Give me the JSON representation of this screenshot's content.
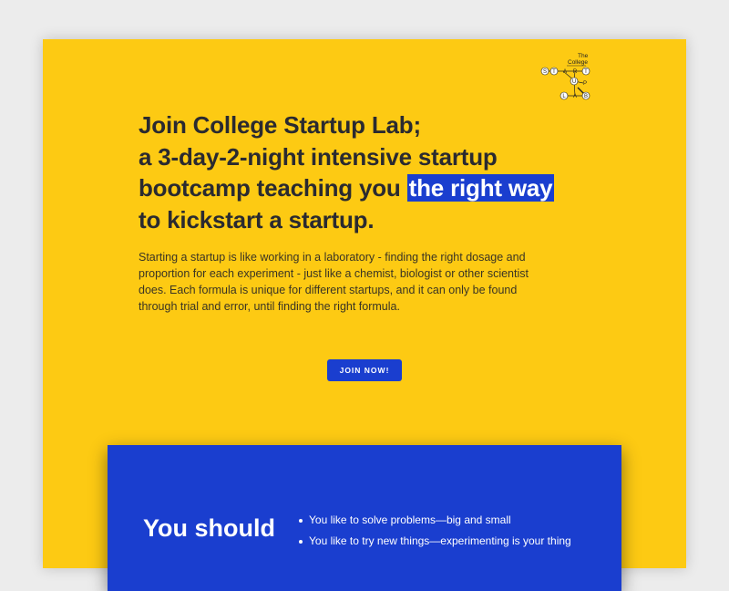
{
  "logo": {
    "title_line1": "The",
    "title_line2": "College",
    "letters": [
      "S",
      "T",
      "A",
      "R",
      "T",
      "U",
      "P",
      "L",
      "A",
      "B"
    ]
  },
  "hero": {
    "headline_line1": "Join College Startup Lab;",
    "headline_line2": "a 3-day-2-night intensive startup",
    "headline_line3_pre": "bootcamp teaching you ",
    "headline_line3_highlight": "the right way",
    "headline_line4": "to kickstart a startup.",
    "intro": "Starting a startup is like working in a laboratory - finding the right dosage and proportion for each experiment - just like a chemist, biologist or other scientist does. Each formula is unique for different startups, and it can only be found through trial and error, until finding the right formula.",
    "cta_label": "JOIN NOW!"
  },
  "section": {
    "title": "You should",
    "items": [
      "You like to solve problems—big and small",
      "You like to try new things—experimenting is your thing"
    ]
  },
  "colors": {
    "background": "#fdca13",
    "accent": "#1a3ecf",
    "text": "#2a2a30"
  }
}
